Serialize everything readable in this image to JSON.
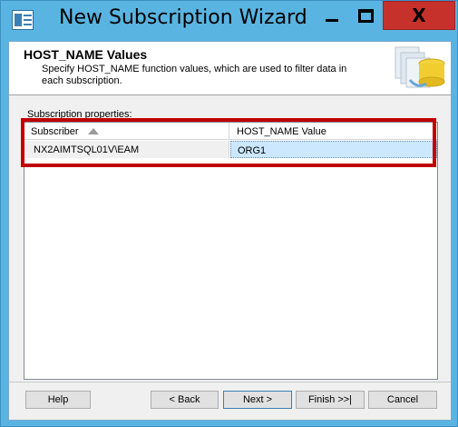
{
  "window": {
    "title": "New Subscription Wizard",
    "controls": {
      "minimize_icon": "minimize-icon",
      "maximize_icon": "maximize-icon",
      "close_glyph": "X"
    }
  },
  "header": {
    "title": "HOST_NAME Values",
    "description": "Specify HOST_NAME function values, which are used to filter data in each subscription.",
    "art_icon": "database-wizard-icon"
  },
  "properties": {
    "group_label": "Subscription properties:",
    "columns": [
      "Subscriber",
      "HOST_NAME Value"
    ],
    "sort_icon": "sort-ascending-icon",
    "rows": [
      {
        "subscriber": "NX2AIMTSQL01V\\EAM",
        "host_name": "ORG1"
      }
    ]
  },
  "buttons": {
    "help": "Help",
    "back": "< Back",
    "next": "Next >",
    "finish": "Finish >>|",
    "cancel": "Cancel"
  },
  "colors": {
    "titlebar": "#59b4e2",
    "close_button": "#c7312b",
    "highlight_box": "#c00000",
    "selected_cell": "#cce8ff"
  }
}
